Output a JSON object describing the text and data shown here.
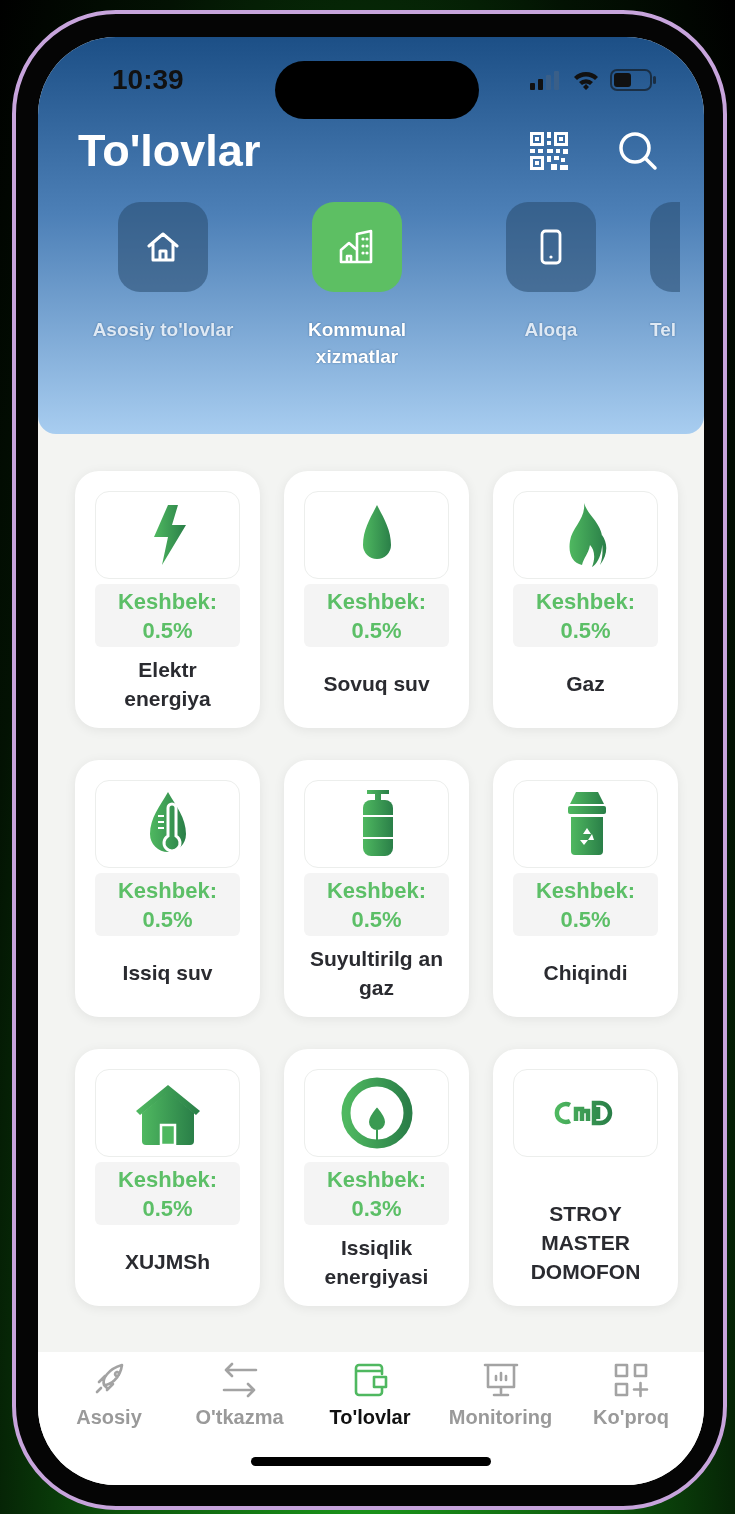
{
  "status_bar": {
    "time": "10:39"
  },
  "header": {
    "title": "To'lovlar"
  },
  "categories": [
    {
      "label": "Asosiy to'lovlar",
      "kind": "home",
      "selected": false
    },
    {
      "label": "Kommunal xizmatlar",
      "kind": "building",
      "selected": true
    },
    {
      "label": "Aloqa",
      "kind": "phone",
      "selected": false
    },
    {
      "label": "Tel",
      "kind": "partial",
      "selected": false
    }
  ],
  "services": [
    {
      "name": "Elektr energiya",
      "cashback_label": "Keshbek:",
      "cashback": "0.5%",
      "kind": "bolt"
    },
    {
      "name": "Sovuq suv",
      "cashback_label": "Keshbek:",
      "cashback": "0.5%",
      "kind": "drop"
    },
    {
      "name": "Gaz",
      "cashback_label": "Keshbek:",
      "cashback": "0.5%",
      "kind": "flame"
    },
    {
      "name": "Issiq suv",
      "cashback_label": "Keshbek:",
      "cashback": "0.5%",
      "kind": "thermo"
    },
    {
      "name": "Suyultirilg an gaz",
      "cashback_label": "Keshbek:",
      "cashback": "0.5%",
      "kind": "cylinder"
    },
    {
      "name": "Chiqindi",
      "cashback_label": "Keshbek:",
      "cashback": "0.5%",
      "kind": "bin"
    },
    {
      "name": "XUJMSh",
      "cashback_label": "Keshbek:",
      "cashback": "0.5%",
      "kind": "house"
    },
    {
      "name": "Issiqlik energiyasi",
      "cashback_label": "Keshbek:",
      "cashback": "0.3%",
      "kind": "ring"
    },
    {
      "name": "STROY MASTER DOMOFON",
      "kind": "logo"
    }
  ],
  "bottom_nav": [
    {
      "label": "Asosiy",
      "kind": "rocket",
      "selected": false
    },
    {
      "label": "O'tkazma",
      "kind": "arrows",
      "selected": false
    },
    {
      "label": "To'lovlar",
      "kind": "wallet",
      "selected": true
    },
    {
      "label": "Monitoring",
      "kind": "board",
      "selected": false
    },
    {
      "label": "Ko'proq",
      "kind": "grid",
      "selected": false
    }
  ]
}
